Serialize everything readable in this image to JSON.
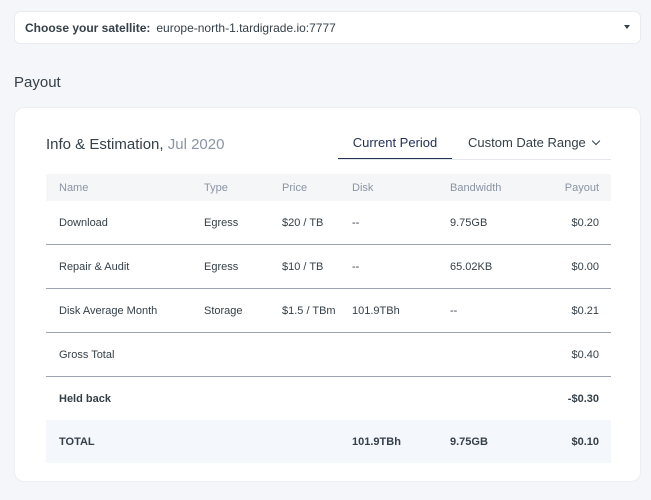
{
  "satellite": {
    "label": "Choose your satellite:",
    "value": "europe-north-1.tardigrade.io:7777"
  },
  "payout_title": "Payout",
  "card": {
    "title": "Info & Estimation,",
    "date": "Jul 2020",
    "tabs": {
      "current": "Current Period",
      "range": "Custom Date Range"
    }
  },
  "table": {
    "headers": [
      "Name",
      "Type",
      "Price",
      "Disk",
      "Bandwidth",
      "Payout"
    ],
    "rows": [
      [
        "Download",
        "Egress",
        "$20 / TB",
        "--",
        "9.75GB",
        "$0.20"
      ],
      [
        "Repair & Audit",
        "Egress",
        "$10 / TB",
        "--",
        "65.02KB",
        "$0.00"
      ],
      [
        "Disk Average Month",
        "Storage",
        "$1.5 / TBm",
        "101.9TBh",
        "--",
        "$0.21"
      ]
    ],
    "gross": {
      "label": "Gross Total",
      "value": "$0.40"
    },
    "held": {
      "label": "Held back",
      "value": "-$0.30"
    },
    "total": {
      "label": "TOTAL",
      "disk": "101.9TBh",
      "bandwidth": "9.75GB",
      "payout": "$0.10"
    }
  }
}
